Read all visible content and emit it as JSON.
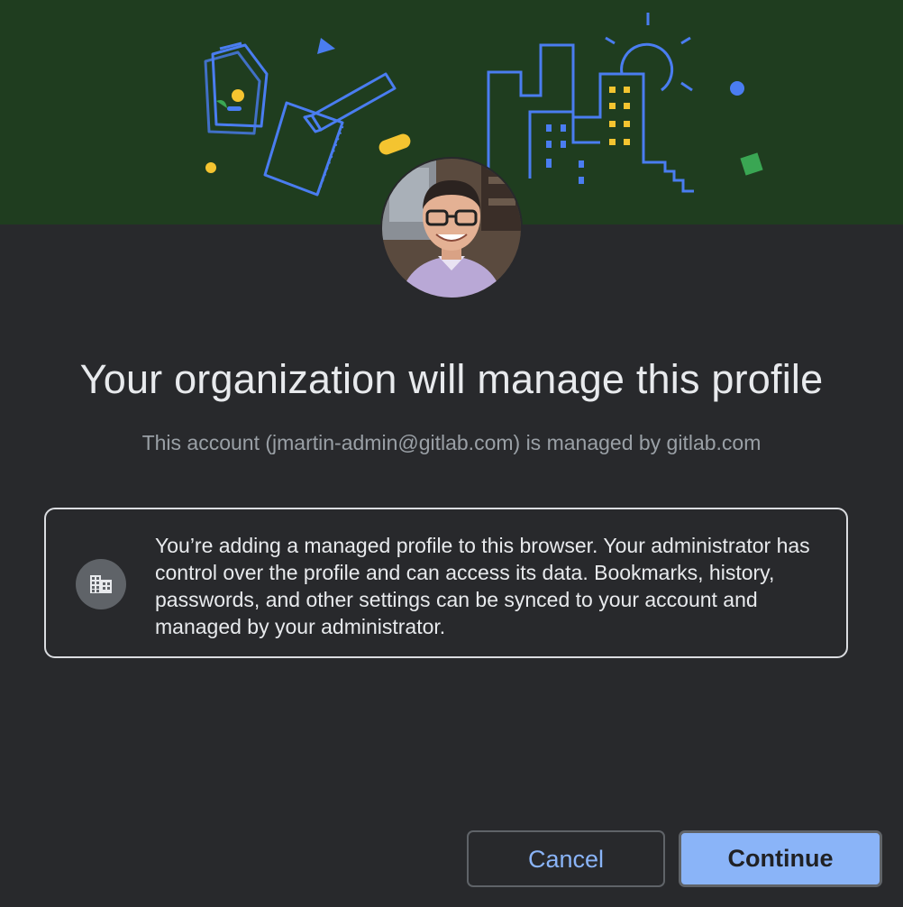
{
  "dialog": {
    "title": "Your organization will manage this profile",
    "subtitle": "This account (jmartin-admin@gitlab.com) is managed by gitlab.com",
    "notice_icon": "business-building-icon",
    "notice_text": "You’re adding a managed profile to this browser. Your administrator has control over the profile and can access its data. Bookmarks, history, passwords, and other settings can be synced to your account and managed by your administrator."
  },
  "banner": {
    "background_color": "#1f3d1f",
    "illustration": "documents-pencil-city-sun-illustration",
    "colors": {
      "blue": "#4a7df0",
      "yellow": "#f4c430",
      "green": "#3aa653"
    }
  },
  "avatar": {
    "icon": "profile-avatar-photo"
  },
  "buttons": {
    "cancel_label": "Cancel",
    "continue_label": "Continue"
  },
  "theme": {
    "background": "#28292c",
    "accent": "#8ab4f8",
    "text_primary": "#e8eaed",
    "text_secondary": "#9aa0a6"
  }
}
